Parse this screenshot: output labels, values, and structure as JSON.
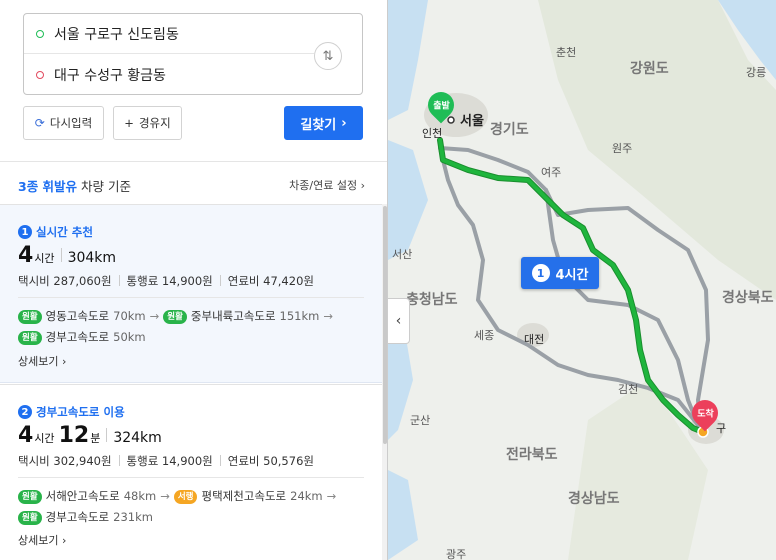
{
  "search": {
    "from": "서울 구로구 신도림동",
    "to": "대구 수성구 황금동",
    "swap_icon": "swap-arrows-icon"
  },
  "buttons": {
    "reset": "다시입력",
    "waypoint": "경유지",
    "go": "길찾기"
  },
  "vehicle": {
    "class_prefix": "3종 휘발유",
    "class_suffix": "차량 기준",
    "settings": "차종/연료 설정"
  },
  "routes": [
    {
      "index": "1",
      "title": "실시간 추천",
      "hours": "4",
      "hours_unit": "시간",
      "minutes": "",
      "minutes_unit": "",
      "distance": "304km",
      "taxi": "택시비 287,060원",
      "toll": "통행료 14,900원",
      "fuel": "연료비 47,420원",
      "roads_line1": [
        {
          "badge": "원활",
          "badge_color": "green",
          "name": "영동고속도로",
          "km": "70km"
        },
        {
          "badge": "원활",
          "badge_color": "green",
          "name": "중부내륙고속도로",
          "km": "151km"
        }
      ],
      "roads_line2": [
        {
          "badge": "원활",
          "badge_color": "green",
          "name": "경부고속도로",
          "km": "50km"
        }
      ],
      "detail": "상세보기"
    },
    {
      "index": "2",
      "title": "경부고속도로 이용",
      "hours": "4",
      "hours_unit": "시간",
      "minutes": "12",
      "minutes_unit": "분",
      "distance": "324km",
      "taxi": "택시비 302,940원",
      "toll": "통행료 14,900원",
      "fuel": "연료비 50,576원",
      "roads_line1": [
        {
          "badge": "원활",
          "badge_color": "green",
          "name": "서해안고속도로",
          "km": "48km"
        },
        {
          "badge": "서행",
          "badge_color": "orange",
          "name": "평택제천고속도로",
          "km": "24km"
        }
      ],
      "roads_line2": [
        {
          "badge": "원활",
          "badge_color": "green",
          "name": "경부고속도로",
          "km": "231km"
        }
      ],
      "detail": "상세보기"
    }
  ],
  "map": {
    "labels": {
      "chuncheon": "춘천",
      "gangwon": "강원도",
      "gangneung": "강릉",
      "incheon": "인천",
      "seoul": "서울",
      "gyeonggi": "경기도",
      "yeoju": "여주",
      "wonju": "원주",
      "seosan": "서산",
      "chungnam": "충청남도",
      "sejong": "세종",
      "daejeon": "대전",
      "gimcheon": "김천",
      "gyeongbuk": "경상북도",
      "gunsan": "군산",
      "jeonbuk": "전라북도",
      "gyeongnam": "경상남도",
      "gwangju": "광주",
      "daegu": "구"
    },
    "start_pin": "출발",
    "end_pin": "도착",
    "time_badge_index": "1",
    "time_badge": "4시간",
    "colors": {
      "route_main": "#1fb53d",
      "route_alt": "#9aa0a6",
      "accent": "#1f6ff0"
    }
  }
}
